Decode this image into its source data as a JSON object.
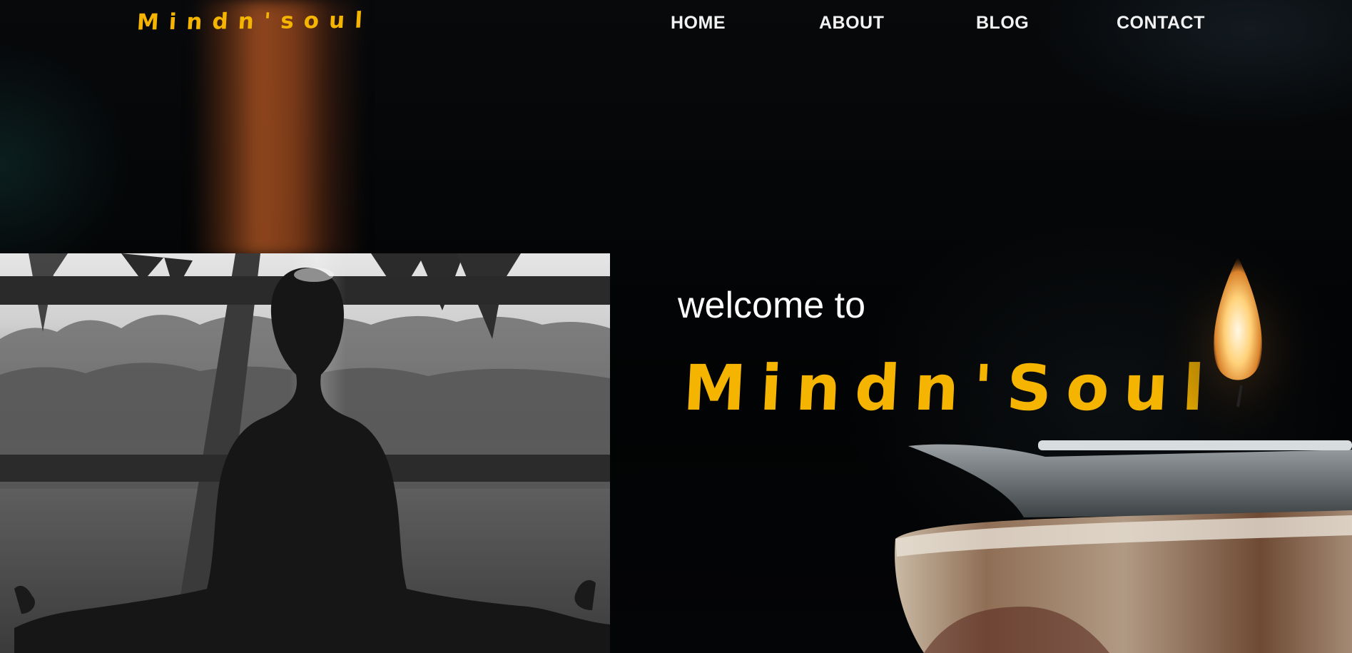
{
  "brand": {
    "logo_text": "Mindn'soul",
    "accent_color": "#f4b400"
  },
  "nav": {
    "items": [
      {
        "label": "HOME"
      },
      {
        "label": "ABOUT"
      },
      {
        "label": "BLOG"
      },
      {
        "label": "CONTACT"
      }
    ]
  },
  "hero": {
    "welcome": "welcome to",
    "brand_title": "Mindn'Soul"
  },
  "images": {
    "left_photo": "person-meditating-photo",
    "right_photo": "candle-lamp-photo"
  }
}
